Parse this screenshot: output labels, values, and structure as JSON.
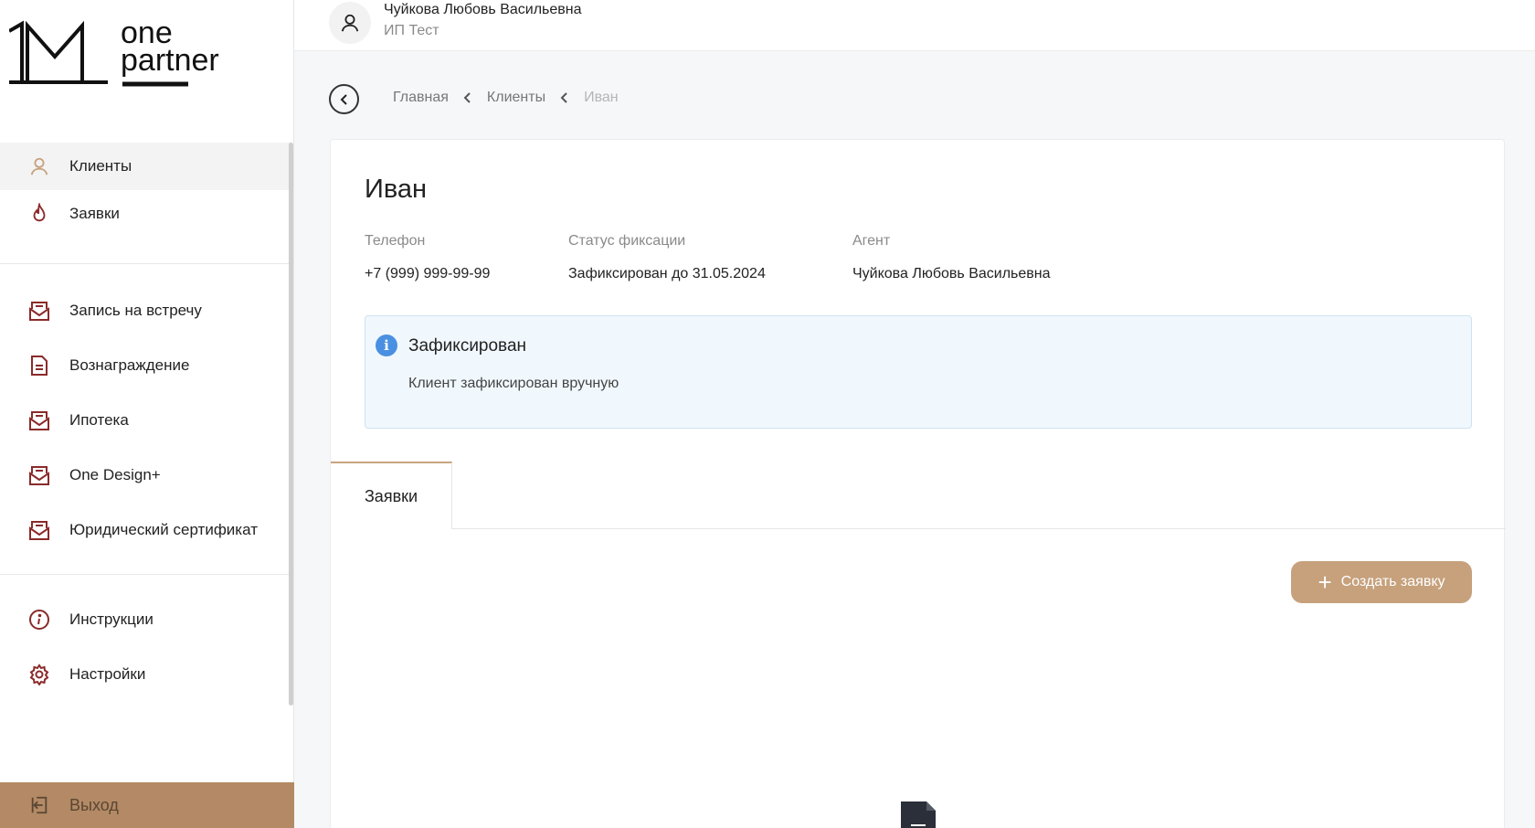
{
  "logo": {
    "mark": "1M",
    "line1": "one",
    "line2": "partner"
  },
  "sidebar": {
    "items": [
      {
        "label": "Клиенты",
        "icon": "user-icon",
        "active": true
      },
      {
        "label": "Заявки",
        "icon": "fire-icon"
      },
      {
        "label": "Запись на встречу",
        "icon": "mail-icon"
      },
      {
        "label": "Вознаграждение",
        "icon": "document-icon"
      },
      {
        "label": "Ипотека",
        "icon": "mail-icon"
      },
      {
        "label": "One Design+",
        "icon": "mail-icon"
      },
      {
        "label": "Юридический сертификат",
        "icon": "mail-icon"
      },
      {
        "label": "Инструкции",
        "icon": "info-icon"
      },
      {
        "label": "Настройки",
        "icon": "gear-icon"
      }
    ],
    "logout": "Выход"
  },
  "header": {
    "user_name": "Чуйкова Любовь Васильевна",
    "user_org": "ИП Тест"
  },
  "breadcrumbs": [
    "Главная",
    "Клиенты",
    "Иван"
  ],
  "client": {
    "name": "Иван",
    "phone_label": "Телефон",
    "phone_value": "+7 (999) 999-99-99",
    "status_label": "Статус фиксации",
    "status_value": "Зафиксирован до 31.05.2024",
    "agent_label": "Агент",
    "agent_value": "Чуйкова Любовь Васильевна"
  },
  "info": {
    "title": "Зафиксирован",
    "text": "Клиент зафиксирован вручную"
  },
  "tabs": [
    "Заявки"
  ],
  "create_button": "Создать заявку",
  "colors": {
    "accent": "#c6a17c",
    "logout_bg": "#b38a65",
    "icon": "#8b2a2a",
    "info_bg": "#f1f8fd",
    "info_icon": "#4a90e2"
  }
}
